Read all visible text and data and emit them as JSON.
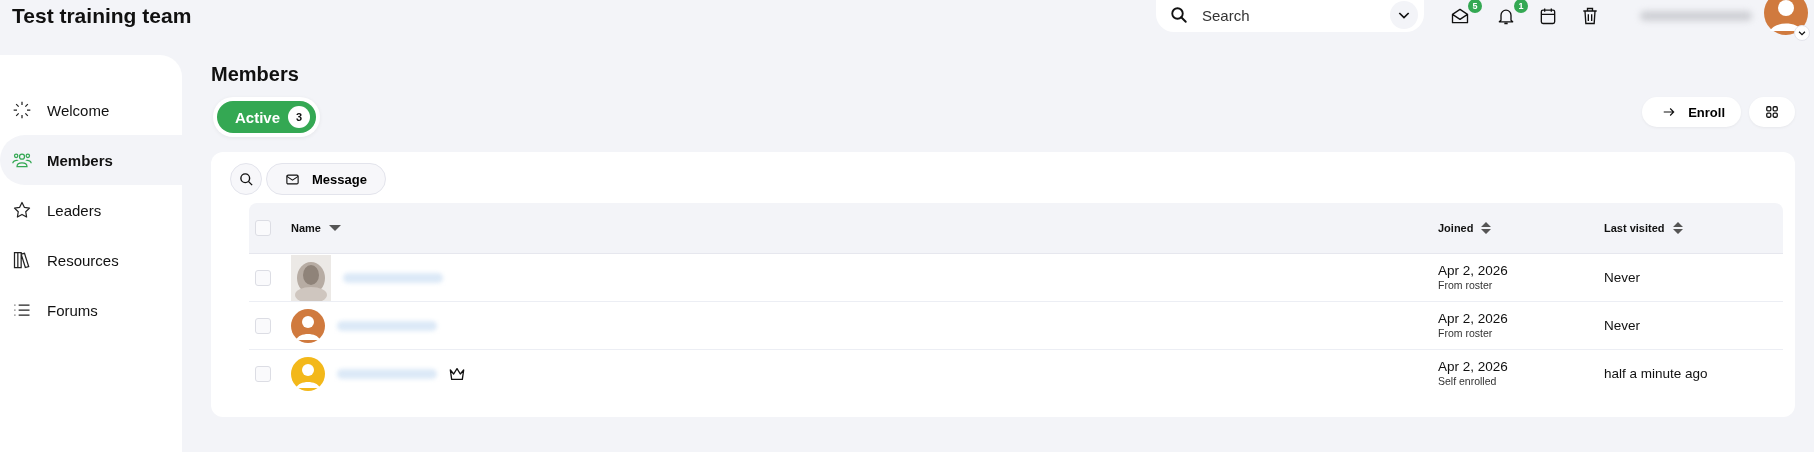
{
  "header": {
    "title": "Test training team",
    "search": {
      "placeholder": "Search"
    },
    "mail_count": "5",
    "notification_count": "1"
  },
  "sidebar": {
    "items": [
      {
        "label": "Welcome",
        "selected": false
      },
      {
        "label": "Members",
        "selected": true
      },
      {
        "label": "Leaders",
        "selected": false
      },
      {
        "label": "Resources",
        "selected": false
      },
      {
        "label": "Forums",
        "selected": false
      }
    ]
  },
  "page": {
    "title": "Members",
    "filters": [
      {
        "label": "Active",
        "count": "3",
        "selected": true
      }
    ],
    "enroll": "Enroll",
    "message": "Message"
  },
  "table": {
    "all_checked": false,
    "columns": [
      {
        "label": "Name",
        "kind": "sorted"
      },
      {
        "label": "Joined",
        "kind": "sortable"
      },
      {
        "label": "Last visited",
        "kind": "sortable"
      }
    ],
    "rows": [
      {
        "checked": false,
        "kind": "picture",
        "leader": false,
        "joined": "Apr 2, 2026",
        "source": "From roster",
        "last_visited": "Never"
      },
      {
        "checked": false,
        "kind": "person",
        "color": "#d07a3e",
        "leader": false,
        "joined": "Apr 2, 2026",
        "source": "From roster",
        "last_visited": "Never"
      },
      {
        "checked": false,
        "kind": "person",
        "color": "#f3b81a",
        "leader": true,
        "joined": "Apr 2, 2026",
        "source": "Self enrolled",
        "last_visited": "half a minute ago"
      }
    ]
  }
}
